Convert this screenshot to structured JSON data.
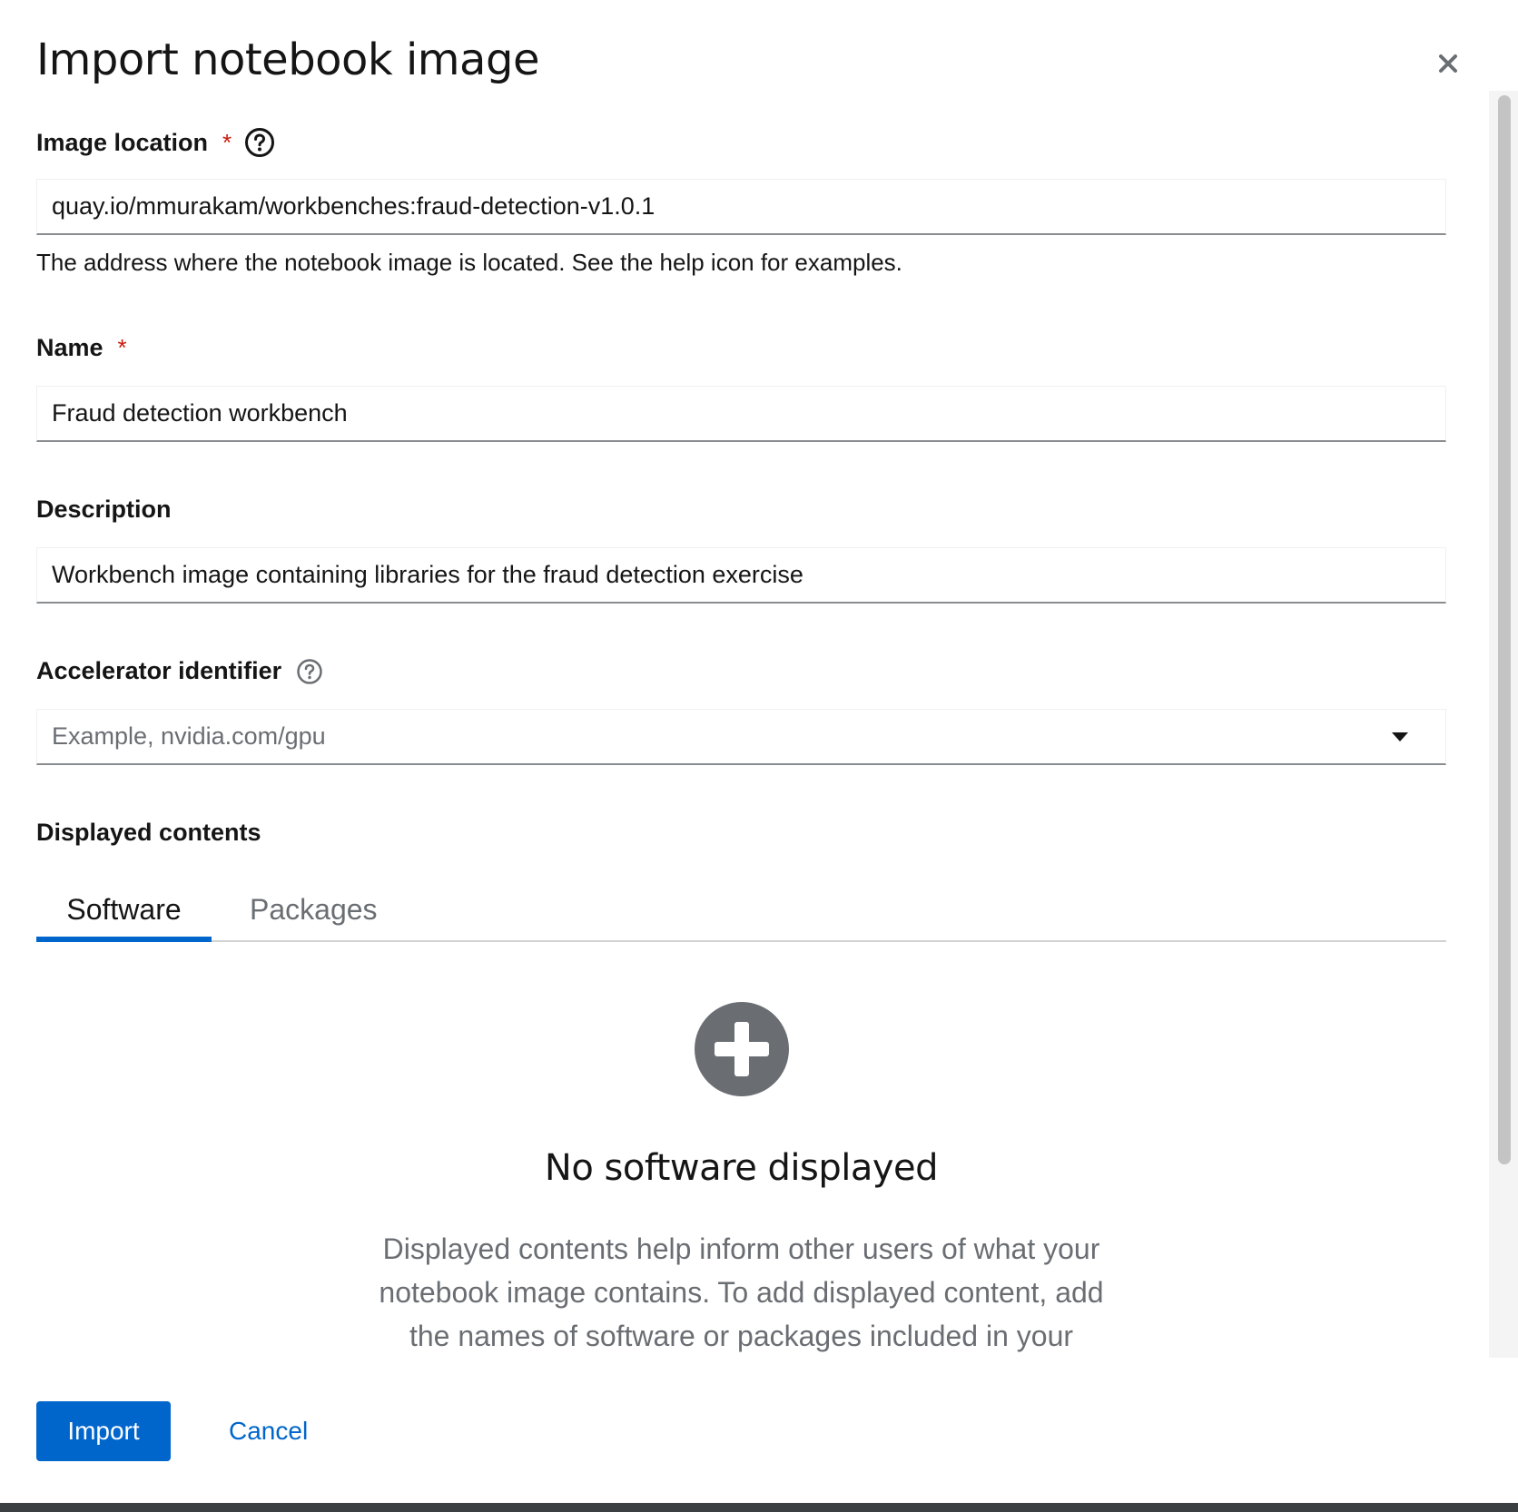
{
  "modal": {
    "title": "Import notebook image"
  },
  "fields": {
    "image_location": {
      "label": "Image location",
      "required_mark": "*",
      "value": "quay.io/mmurakam/workbenches:fraud-detection-v1.0.1",
      "helper": "The address where the notebook image is located. See the help icon for examples."
    },
    "name": {
      "label": "Name",
      "required_mark": "*",
      "value": "Fraud detection workbench"
    },
    "description": {
      "label": "Description",
      "value": "Workbench image containing libraries for the fraud detection exercise"
    },
    "accelerator": {
      "label": "Accelerator identifier",
      "placeholder": "Example, nvidia.com/gpu"
    }
  },
  "displayed_contents": {
    "label": "Displayed contents",
    "tabs": [
      {
        "label": "Software",
        "active": true
      },
      {
        "label": "Packages",
        "active": false
      }
    ],
    "empty_state": {
      "title": "No software displayed",
      "body": "Displayed contents help inform other users of what your notebook image contains. To add displayed content, add the names of software or packages included in your"
    }
  },
  "footer": {
    "import_label": "Import",
    "cancel_label": "Cancel"
  },
  "icons": {
    "close": "close-icon",
    "help": "help-icon",
    "caret": "caret-down-icon",
    "empty": "plus-circle-icon"
  },
  "colors": {
    "primary": "#0066cc",
    "required": "#c9190b",
    "tab_active_underline": "#0066cc",
    "empty_icon": "#6a6e73"
  }
}
